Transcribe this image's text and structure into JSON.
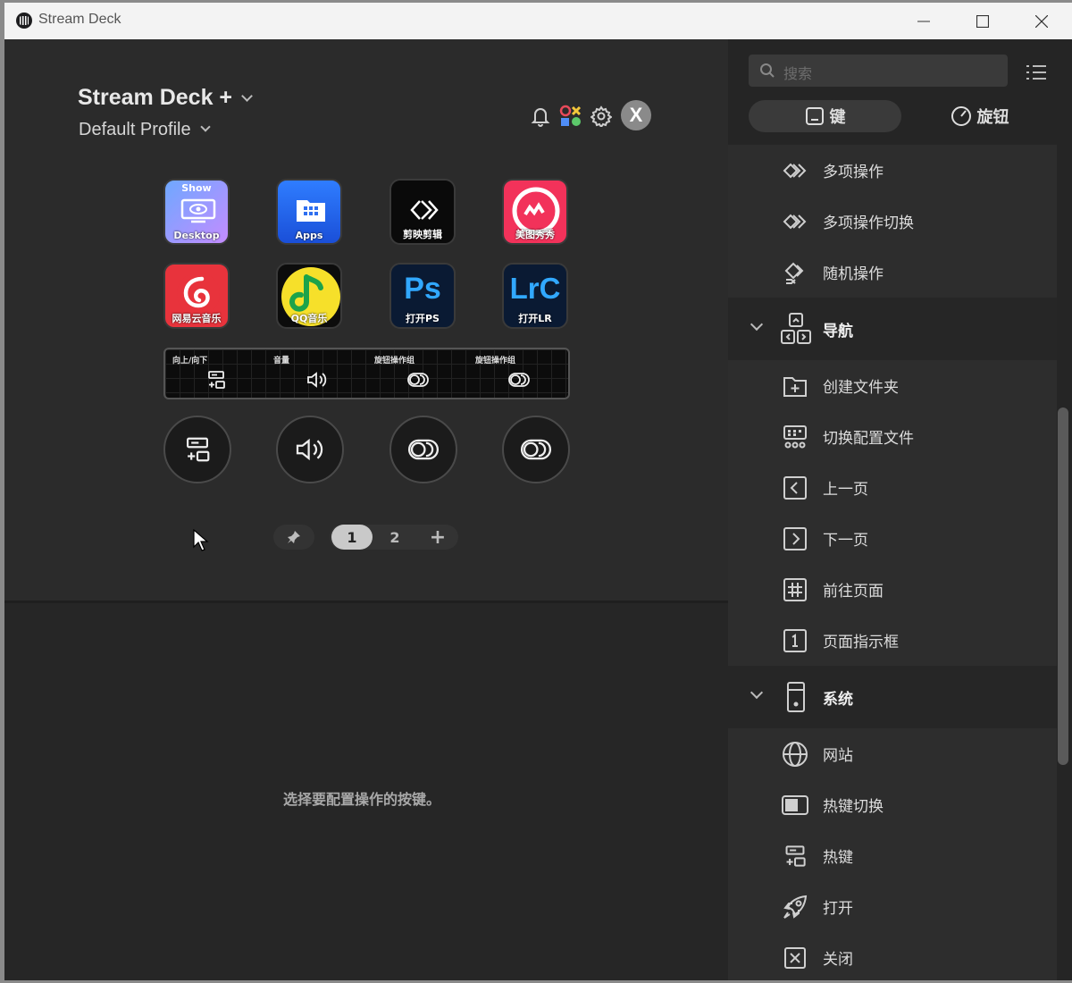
{
  "window": {
    "title": "Stream Deck"
  },
  "header": {
    "device": "Stream Deck +",
    "profile": "Default Profile",
    "badge": "X"
  },
  "keys": [
    {
      "top": "Show",
      "cap": "Desktop"
    },
    {
      "cap": "Apps"
    },
    {
      "cap": "剪映剪辑"
    },
    {
      "cap": "美图秀秀"
    },
    {
      "cap": "网易云音乐"
    },
    {
      "cap": "QQ音乐"
    },
    {
      "logo": "Ps",
      "cap": "打开PS"
    },
    {
      "logo": "LrC",
      "cap": "打开LR"
    }
  ],
  "lcd": [
    "向上/向下",
    "音量",
    "旋钮操作组",
    "旋钮操作组"
  ],
  "pager": {
    "pages": [
      "1",
      "2"
    ],
    "add": "+"
  },
  "main": {
    "hint": "选择要配置操作的按键。"
  },
  "sidebar": {
    "search_placeholder": "搜索",
    "tabs": [
      "键",
      "旋钮"
    ],
    "items_a": [
      "多项操作",
      "多项操作切换",
      "随机操作"
    ],
    "cat_nav": "导航",
    "items_nav": [
      "创建文件夹",
      "切换配置文件",
      "上一页",
      "下一页",
      "前往页面",
      "页面指示框"
    ],
    "cat_sys": "系统",
    "items_sys": [
      "网站",
      "热键切换",
      "热键",
      "打开",
      "关闭"
    ]
  }
}
